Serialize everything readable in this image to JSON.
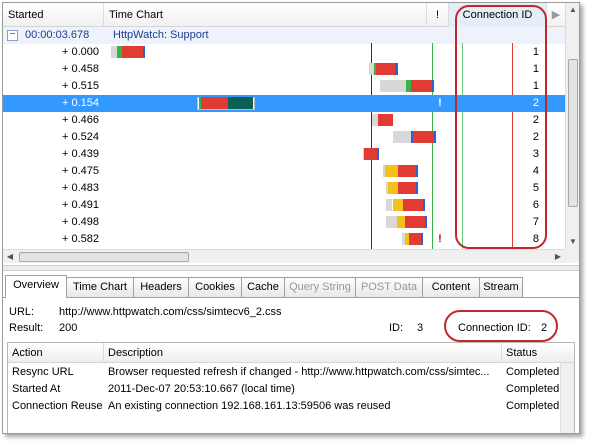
{
  "colors": {
    "selected_row": "#3399ff",
    "callout": "#c0282a",
    "wait_green": "#38b54a",
    "receive_red": "#e13b33",
    "send_blue": "#2a62d8",
    "dns_yellow": "#f2c21a",
    "blocked_grey": "#d8d8d8",
    "cached_teal": "#0e5f58"
  },
  "grid": {
    "columns": {
      "started": "Started",
      "time_chart": "Time Chart",
      "warning": "!",
      "connection_id": "Connection ID"
    },
    "group": {
      "time": "00:00:03.678",
      "name": "HttpWatch: Support",
      "expander_glyph": "−"
    },
    "rows": [
      {
        "started": "+ 0.000",
        "warning": "",
        "connection_id": "1",
        "selected": false,
        "bars": [
          {
            "phase": "blocked",
            "from": 0.0,
            "to": 0.01
          },
          {
            "phase": "wait",
            "from": 0.01,
            "to": 0.02
          },
          {
            "phase": "receive",
            "from": 0.02,
            "to": 0.055
          },
          {
            "phase": "send",
            "from": 0.055,
            "to": 0.058
          }
        ]
      },
      {
        "started": "+ 0.458",
        "warning": "",
        "connection_id": "1",
        "selected": false,
        "bars": [
          {
            "phase": "blocked",
            "from": 0.45,
            "to": 0.458
          },
          {
            "phase": "wait",
            "from": 0.458,
            "to": 0.462
          },
          {
            "phase": "receive",
            "from": 0.462,
            "to": 0.496
          },
          {
            "phase": "send",
            "from": 0.496,
            "to": 0.5
          }
        ]
      },
      {
        "started": "+ 0.515",
        "warning": "",
        "connection_id": "1",
        "selected": false,
        "bars": [
          {
            "phase": "blocked",
            "from": 0.47,
            "to": 0.515
          },
          {
            "phase": "wait",
            "from": 0.515,
            "to": 0.523
          },
          {
            "phase": "receive",
            "from": 0.523,
            "to": 0.56
          },
          {
            "phase": "send",
            "from": 0.56,
            "to": 0.563
          }
        ]
      },
      {
        "started": "+ 0.154",
        "warning": "!",
        "connection_id": "2",
        "selected": true,
        "bars": [
          {
            "phase": "wait",
            "from": 0.154,
            "to": 0.157
          },
          {
            "phase": "receive",
            "from": 0.157,
            "to": 0.204
          },
          {
            "phase": "cached",
            "from": 0.204,
            "to": 0.247
          }
        ]
      },
      {
        "started": "+ 0.466",
        "warning": "",
        "connection_id": "2",
        "selected": false,
        "bars": [
          {
            "phase": "blocked",
            "from": 0.455,
            "to": 0.466
          },
          {
            "phase": "receive",
            "from": 0.466,
            "to": 0.492
          }
        ]
      },
      {
        "started": "+ 0.524",
        "warning": "",
        "connection_id": "2",
        "selected": false,
        "bars": [
          {
            "phase": "blocked",
            "from": 0.492,
            "to": 0.524
          },
          {
            "phase": "send",
            "from": 0.524,
            "to": 0.527
          },
          {
            "phase": "receive",
            "from": 0.527,
            "to": 0.563
          },
          {
            "phase": "send",
            "from": 0.563,
            "to": 0.566
          }
        ]
      },
      {
        "started": "+ 0.439",
        "warning": "",
        "connection_id": "3",
        "selected": false,
        "bars": [
          {
            "phase": "blocked",
            "from": 0.439,
            "to": 0.442
          },
          {
            "phase": "receive",
            "from": 0.442,
            "to": 0.464
          },
          {
            "phase": "send",
            "from": 0.464,
            "to": 0.466
          }
        ]
      },
      {
        "started": "+ 0.475",
        "warning": "",
        "connection_id": "4",
        "selected": false,
        "bars": [
          {
            "phase": "blocked",
            "from": 0.475,
            "to": 0.478
          },
          {
            "phase": "dns",
            "from": 0.478,
            "to": 0.5
          },
          {
            "phase": "receive",
            "from": 0.5,
            "to": 0.532
          },
          {
            "phase": "send",
            "from": 0.532,
            "to": 0.535
          }
        ]
      },
      {
        "started": "+ 0.483",
        "warning": "",
        "connection_id": "5",
        "selected": false,
        "bars": [
          {
            "phase": "blocked",
            "from": 0.48,
            "to": 0.483
          },
          {
            "phase": "dns",
            "from": 0.483,
            "to": 0.5
          },
          {
            "phase": "receive",
            "from": 0.5,
            "to": 0.532
          },
          {
            "phase": "send",
            "from": 0.532,
            "to": 0.535
          }
        ]
      },
      {
        "started": "+ 0.491",
        "warning": "",
        "connection_id": "6",
        "selected": false,
        "bars": [
          {
            "phase": "blocked",
            "from": 0.48,
            "to": 0.491
          },
          {
            "phase": "dns",
            "from": 0.491,
            "to": 0.509
          },
          {
            "phase": "receive",
            "from": 0.509,
            "to": 0.544
          },
          {
            "phase": "send",
            "from": 0.544,
            "to": 0.548
          }
        ]
      },
      {
        "started": "+ 0.498",
        "warning": "",
        "connection_id": "7",
        "selected": false,
        "bars": [
          {
            "phase": "blocked",
            "from": 0.48,
            "to": 0.498
          },
          {
            "phase": "dns",
            "from": 0.498,
            "to": 0.513
          },
          {
            "phase": "receive",
            "from": 0.513,
            "to": 0.548
          },
          {
            "phase": "send",
            "from": 0.548,
            "to": 0.551
          }
        ]
      },
      {
        "started": "+ 0.582",
        "warning": "!",
        "connection_id": "8",
        "selected": false,
        "bars": [
          {
            "phase": "blocked",
            "from": 0.508,
            "to": 0.513
          },
          {
            "phase": "dns",
            "from": 0.513,
            "to": 0.519
          },
          {
            "phase": "receive",
            "from": 0.519,
            "to": 0.54
          },
          {
            "phase": "send",
            "from": 0.54,
            "to": 0.542
          }
        ]
      }
    ],
    "time_axis": {
      "min": 0.0,
      "max": 0.75
    },
    "markers": [
      {
        "name": "render-start-line",
        "time": 0.454,
        "color": "#1a2a9c"
      },
      {
        "name": "dom-load-line",
        "time": 0.56,
        "color": "#38b54a"
      },
      {
        "name": "page-load-line",
        "time": 0.613,
        "color": "#6ac97a"
      },
      {
        "name": "page-complete-line",
        "time": 0.7,
        "color": "#e13b33"
      }
    ]
  },
  "tabs": [
    {
      "label": "Overview",
      "active": true,
      "disabled": false
    },
    {
      "label": "Time Chart",
      "active": false,
      "disabled": false
    },
    {
      "label": "Headers",
      "active": false,
      "disabled": false
    },
    {
      "label": "Cookies",
      "active": false,
      "disabled": false
    },
    {
      "label": "Cache",
      "active": false,
      "disabled": false
    },
    {
      "label": "Query String",
      "active": false,
      "disabled": true
    },
    {
      "label": "POST Data",
      "active": false,
      "disabled": true
    },
    {
      "label": "Content",
      "active": false,
      "disabled": false
    },
    {
      "label": "Stream",
      "active": false,
      "disabled": false
    }
  ],
  "overview": {
    "url_label": "URL:",
    "url_value": "http://www.httpwatch.com/css/simtecv6_2.css",
    "result_label": "Result:",
    "result_value": "200",
    "id_label": "ID:",
    "id_value": "3",
    "conn_label": "Connection ID:",
    "conn_value": "2",
    "columns": {
      "action": "Action",
      "description": "Description",
      "status": "Status"
    },
    "rows": [
      {
        "action": "Resync URL",
        "description": "Browser requested refresh if changed - http://www.httpwatch.com/css/simtec...",
        "status": "Completed"
      },
      {
        "action": "Started At",
        "description": "2011-Dec-07 20:53:10.667 (local time)",
        "status": "Completed"
      },
      {
        "action": "Connection Reuse",
        "description": "An existing connection 192.168.161.13:59506 was reused",
        "status": "Completed"
      }
    ]
  },
  "icons": {
    "more_columns": "▶",
    "scroll_up": "▲",
    "scroll_down": "▼",
    "scroll_left": "◀",
    "scroll_right": "▶",
    "grip": "≡",
    "grip_h": "|||"
  }
}
